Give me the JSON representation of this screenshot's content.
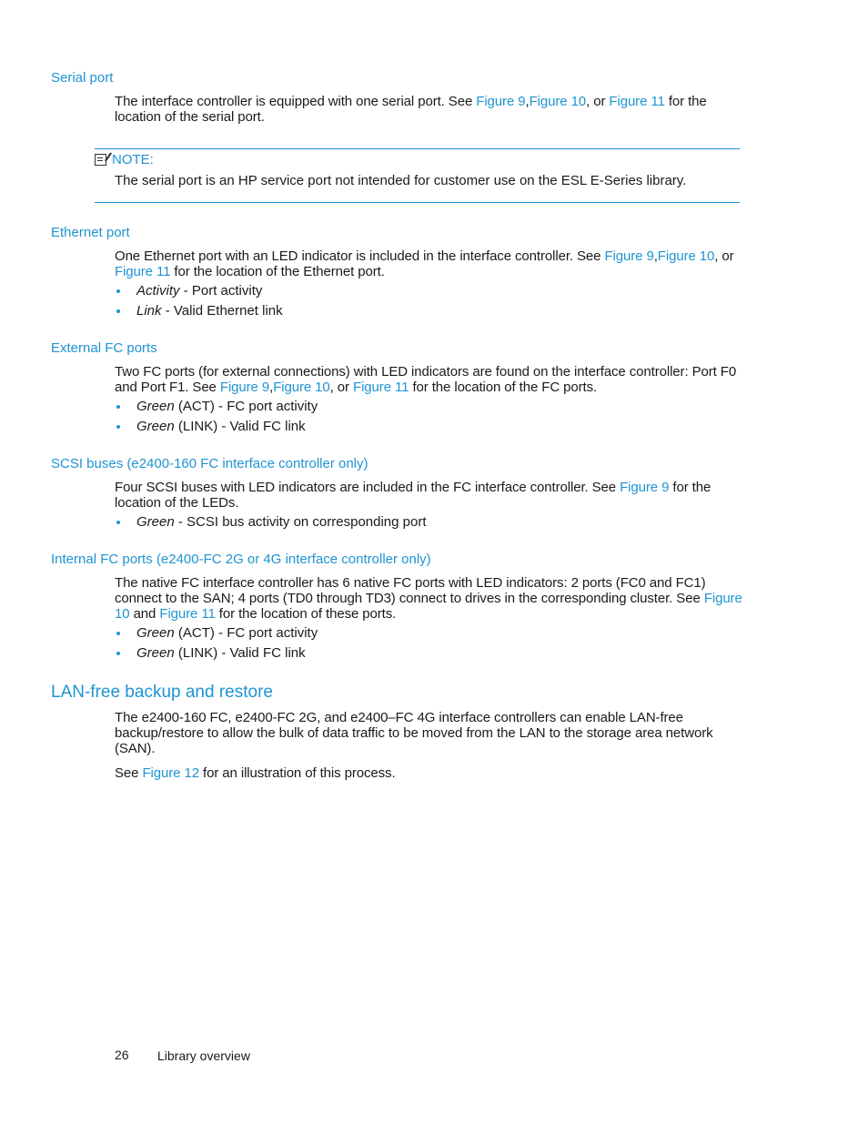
{
  "sections": {
    "serial": {
      "heading": "Serial port",
      "p1": {
        "t1": "The interface controller is equipped with one serial port.  See ",
        "l1": "Figure 9",
        "t2": ",",
        "l2": "Figure 10",
        "t3": ", or ",
        "l3": "Figure 11",
        "t4": " for the location of the serial port."
      },
      "note": {
        "icon": "note-icon",
        "label": "NOTE:",
        "body": "The serial port is an HP service port not intended for customer use on the ESL E-Series library."
      }
    },
    "ethernet": {
      "heading": "Ethernet port",
      "p1": {
        "t1": "One Ethernet port with an LED indicator is included in the interface controller.  See ",
        "l1": "Figure 9",
        "t2": ",",
        "l2": "Figure 10",
        "t3": ", or ",
        "l3": "Figure 11",
        "t4": " for the location of the Ethernet port."
      },
      "bullets": [
        {
          "term": "Activity",
          "desc": " - Port activity"
        },
        {
          "term": "Link",
          "desc": " - Valid Ethernet link"
        }
      ]
    },
    "external_fc": {
      "heading": "External FC ports",
      "p1": {
        "t1": "Two FC ports (for external connections) with LED indicators are found on the interface controller: Port F0 and Port F1.  See ",
        "l1": "Figure 9",
        "t2": ",",
        "l2": "Figure 10",
        "t3": ", or ",
        "l3": "Figure 11",
        "t4": " for the location of the FC ports."
      },
      "bullets": [
        {
          "term": "Green",
          "desc": " (ACT) - FC port activity"
        },
        {
          "term": "Green",
          "desc": " (LINK) - Valid FC link"
        }
      ]
    },
    "scsi": {
      "heading": "SCSI buses (e2400-160 FC interface controller only)",
      "p1": {
        "t1": "Four SCSI buses with LED indicators are included in the FC interface controller.  See ",
        "l1": "Figure 9",
        "t2": " for the location of the LEDs."
      },
      "bullets": [
        {
          "term": "Green",
          "desc": " - SCSI bus activity on corresponding port"
        }
      ]
    },
    "internal_fc": {
      "heading": "Internal FC ports (e2400-FC 2G or 4G interface controller only)",
      "p1": {
        "t1": "The native FC interface controller has 6 native FC ports with LED indicators:  2 ports (FC0 and FC1) connect to the SAN; 4 ports (TD0 through TD3) connect to drives in the corresponding cluster.  See ",
        "l1": "Figure 10",
        "t2": " and ",
        "l2": "Figure 11",
        "t3": " for the location of these ports."
      },
      "bullets": [
        {
          "term": "Green",
          "desc": " (ACT) - FC port activity"
        },
        {
          "term": "Green",
          "desc": " (LINK) - Valid FC link"
        }
      ]
    },
    "lanfree": {
      "heading": "LAN-free backup and restore",
      "p1": "The e2400-160 FC, e2400-FC 2G, and e2400–FC 4G interface controllers can enable LAN-free backup/restore to allow the bulk of data traffic to be moved from the LAN to the storage area network (SAN).",
      "p2": {
        "t1": "See ",
        "l1": "Figure 12",
        "t2": " for an illustration of this process."
      }
    }
  },
  "footer": {
    "page_number": "26",
    "chapter_title": "Library overview"
  },
  "colors": {
    "accent": "#1f94d2",
    "text": "#1a1a1a"
  }
}
